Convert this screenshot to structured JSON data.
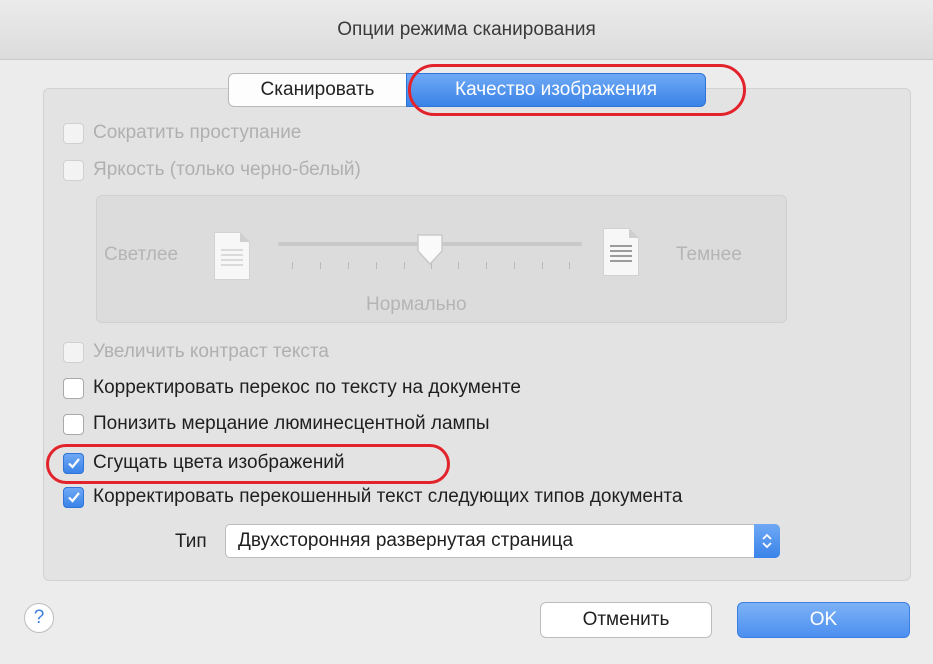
{
  "window": {
    "title": "Опции режима сканирования"
  },
  "tabs": [
    {
      "label": "Сканировать",
      "selected": false
    },
    {
      "label": "Качество изображения",
      "selected": true
    }
  ],
  "options": {
    "reduce_bleed": {
      "label": "Сократить проступание",
      "checked": false,
      "enabled": false
    },
    "brightness": {
      "label": "Яркость (только черно-белый)",
      "checked": false,
      "enabled": false
    },
    "contrast": {
      "label": "Увеличить контраст текста",
      "checked": false,
      "enabled": false
    },
    "deskew_text": {
      "label": "Корректировать перекос по тексту на документе",
      "checked": false,
      "enabled": true
    },
    "flicker": {
      "label": "Понизить мерцание люминесцентной лампы",
      "checked": false,
      "enabled": true
    },
    "compress_colors": {
      "label": "Сгущать цвета изображений",
      "checked": true,
      "enabled": true
    },
    "skew_types": {
      "label": "Корректировать перекошенный текст следующих типов документа",
      "checked": true,
      "enabled": true
    }
  },
  "brightness_slider": {
    "lighter_label": "Светлее",
    "darker_label": "Темнее",
    "value_label": "Нормально",
    "level": 0.5
  },
  "type_select": {
    "label": "Тип",
    "value": "Двухсторонняя развернутая страница"
  },
  "buttons": {
    "help": "?",
    "cancel": "Отменить",
    "ok": "OK"
  },
  "colors": {
    "accent": "#3a83e8",
    "highlight_ring": "#e3232c"
  }
}
